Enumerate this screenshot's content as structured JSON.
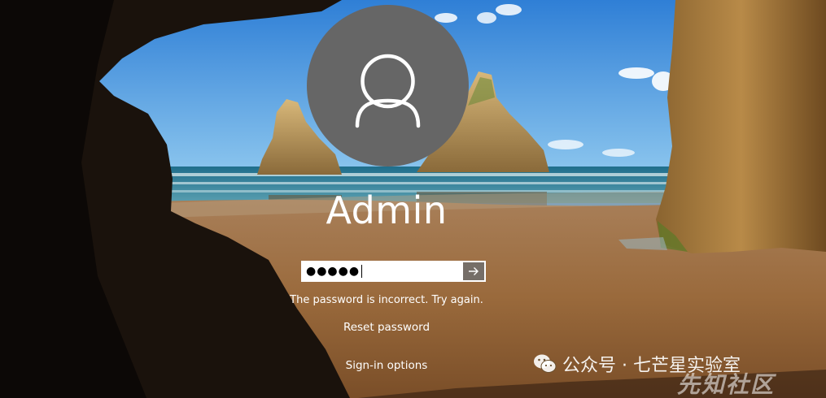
{
  "login": {
    "username": "Admin",
    "password_mask": "●●●●●",
    "error_message": "The password is incorrect. Try again.",
    "reset_password_label": "Reset password",
    "sign_in_options_label": "Sign-in options"
  },
  "icons": {
    "avatar": "user-icon",
    "submit": "arrow-right-icon"
  },
  "watermark": {
    "text": "公众号 · 七芒星实验室",
    "site": "先知社区"
  },
  "colors": {
    "avatar_bg": "#666666",
    "text": "#ffffff"
  }
}
